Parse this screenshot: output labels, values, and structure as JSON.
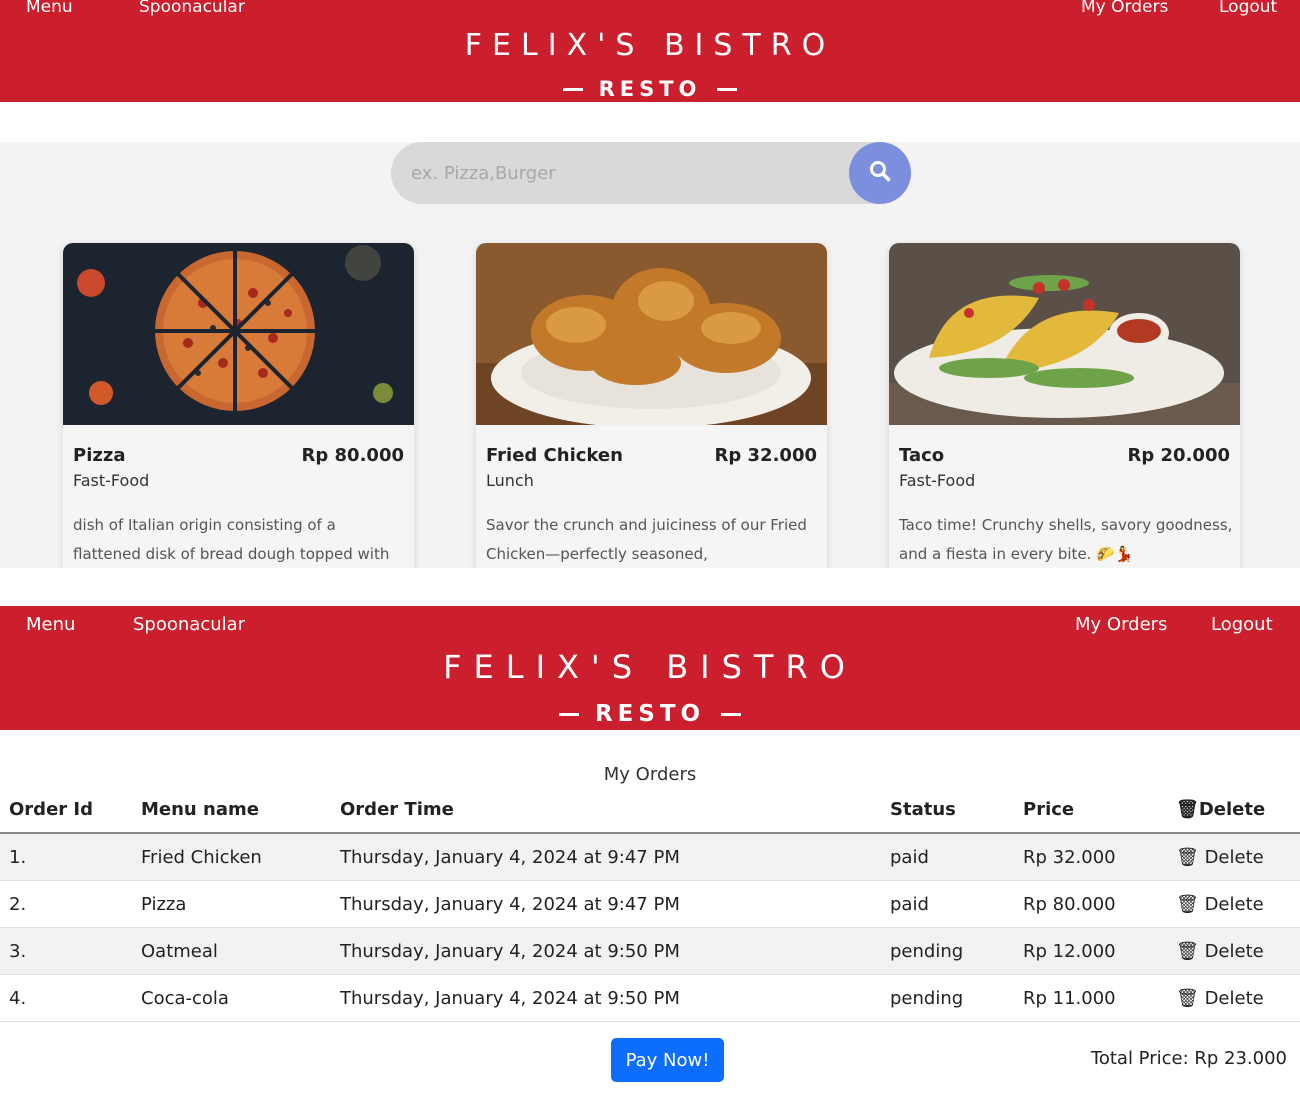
{
  "header_top": {
    "menu": "Menu",
    "spoonacular": "Spoonacular",
    "my_orders": "My Orders",
    "logout": "Logout",
    "brand": "FELIX'S BISTRO",
    "sub": "RESTO"
  },
  "search": {
    "placeholder": "ex. Pizza,Burger",
    "icon": "search-icon"
  },
  "cards": [
    {
      "name": "Pizza",
      "price": "Rp 80.000",
      "category": "Fast-Food",
      "description": "dish of Italian origin consisting of a flattened disk of bread dough topped with"
    },
    {
      "name": "Fried Chicken",
      "price": "Rp 32.000",
      "category": "Lunch",
      "description": "Savor the crunch and juiciness of our Fried Chicken—perfectly seasoned,"
    },
    {
      "name": "Taco",
      "price": "Rp 20.000",
      "category": "Fast-Food",
      "description": "Taco time! Crunchy shells, savory goodness, and a fiesta in every bite. 🌮💃"
    }
  ],
  "header_bottom": {
    "menu": "Menu",
    "spoonacular": "Spoonacular",
    "my_orders": "My Orders",
    "logout": "Logout",
    "brand": "FELIX'S BISTRO",
    "sub": "RESTO"
  },
  "orders": {
    "title": "My Orders",
    "headers": [
      "Order Id",
      "Menu name",
      "Order Time",
      "Status",
      "Price",
      "🗑Delete"
    ],
    "rows": [
      {
        "id": "1.",
        "menu": "Fried Chicken",
        "time": "Thursday, January 4, 2024 at 9:47 PM",
        "status": "paid",
        "price": "Rp 32.000",
        "delete": "🗑 Delete"
      },
      {
        "id": "2.",
        "menu": "Pizza",
        "time": "Thursday, January 4, 2024 at 9:47 PM",
        "status": "paid",
        "price": "Rp 80.000",
        "delete": "🗑 Delete"
      },
      {
        "id": "3.",
        "menu": "Oatmeal",
        "time": "Thursday, January 4, 2024 at 9:50 PM",
        "status": "pending",
        "price": "Rp 12.000",
        "delete": "🗑 Delete"
      },
      {
        "id": "4.",
        "menu": "Coca-cola",
        "time": "Thursday, January 4, 2024 at 9:50 PM",
        "status": "pending",
        "price": "Rp 11.000",
        "delete": "🗑 Delete"
      }
    ],
    "pay_label": "Pay Now!",
    "total": "Total Price: Rp 23.000"
  },
  "colors": {
    "brand_red": "#cb1f2e",
    "search_button": "#7c8fdf",
    "pay_button": "#0d6efd"
  }
}
